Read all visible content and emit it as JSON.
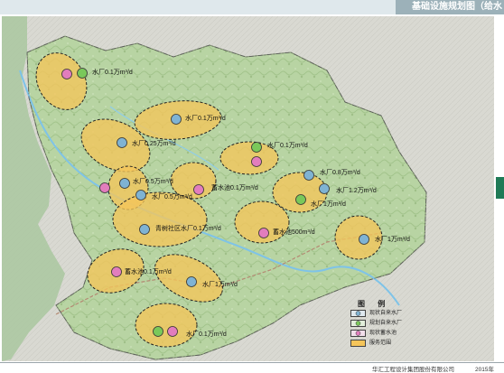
{
  "header": {
    "title": "基础设施规划图（给水"
  },
  "footer": {
    "company": "华汇工程设计集团股份有限公司",
    "year": "2015年"
  },
  "legend": {
    "title": "图 例",
    "items": [
      {
        "label": "现状自来水厂",
        "color": "#7fb3d3"
      },
      {
        "label": "规划自来水厂",
        "color": "#7ac85a"
      },
      {
        "label": "现状蓄水池",
        "color": "#e27dbd"
      },
      {
        "label": "服务范围",
        "color": "#f5c55a"
      }
    ]
  },
  "facilities": [
    {
      "label": "水厂0.1万m³/d",
      "type": "planned-plant"
    },
    {
      "label": "水厂0.1万m³/d",
      "type": "existing-plant"
    },
    {
      "label": "水厂0.25万m³/d",
      "type": "existing-plant"
    },
    {
      "label": "水厂0.1万m³/d",
      "type": "planned-plant"
    },
    {
      "label": "水厂0.5万m³/d",
      "type": "existing-plant"
    },
    {
      "label": "水厂0.5万m³/d",
      "type": "existing-plant"
    },
    {
      "label": "蓄水池0.1万m³/d",
      "type": "reservoir"
    },
    {
      "label": "水厂0.8万m³/d",
      "type": "existing-plant"
    },
    {
      "label": "水厂1.2万m³/d",
      "type": "existing-plant"
    },
    {
      "label": "水厂1万m³/d",
      "type": "planned-plant"
    },
    {
      "label": "青树社区水厂0.1万m³/d",
      "type": "existing-plant"
    },
    {
      "label": "蓄水池500m³/d",
      "type": "reservoir"
    },
    {
      "label": "水厂1万m³/d",
      "type": "existing-plant"
    },
    {
      "label": "蓄水池0.1万m³/d",
      "type": "reservoir"
    },
    {
      "label": "水厂1万m³/d",
      "type": "existing-plant"
    },
    {
      "label": "水厂0.1万m³/d",
      "type": "planned-plant"
    }
  ]
}
